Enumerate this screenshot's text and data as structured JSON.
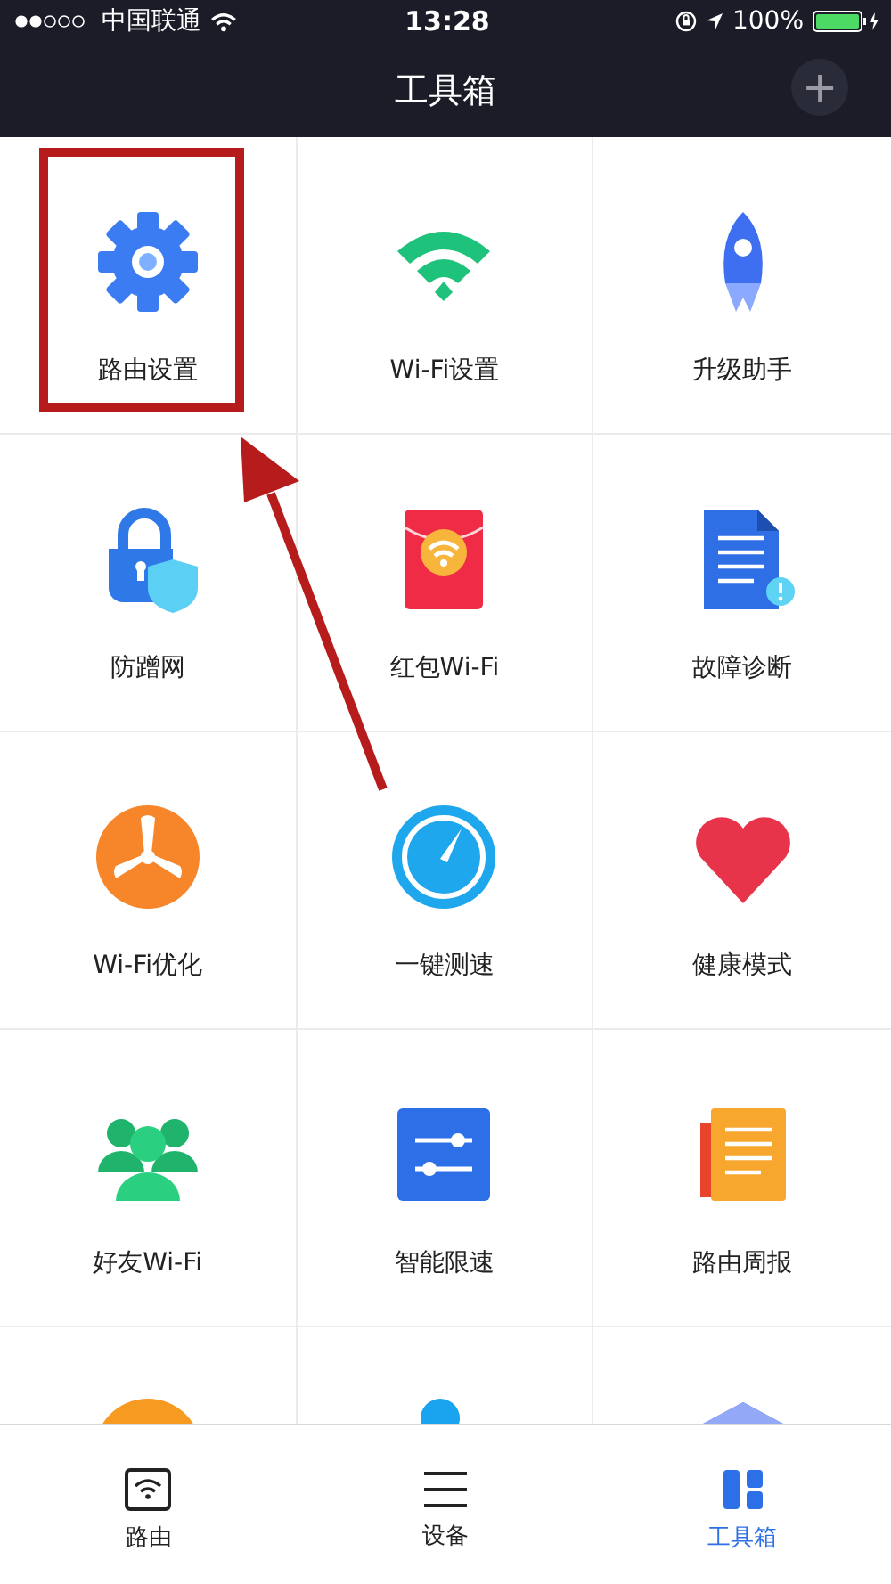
{
  "status_bar": {
    "carrier": "中国联通",
    "time": "13:28",
    "battery": "100%"
  },
  "header": {
    "title": "工具箱",
    "add_button": "+"
  },
  "tools": [
    {
      "kind": "gear",
      "label": "路由设置",
      "highlighted": true
    },
    {
      "kind": "wifi",
      "label": "Wi-Fi设置",
      "highlighted": false
    },
    {
      "kind": "rocket",
      "label": "升级助手",
      "highlighted": false
    },
    {
      "kind": "lock",
      "label": "防蹭网",
      "highlighted": false
    },
    {
      "kind": "envelope",
      "label": "红包Wi-Fi",
      "highlighted": false
    },
    {
      "kind": "document",
      "label": "故障诊断",
      "highlighted": false
    },
    {
      "kind": "fan",
      "label": "Wi-Fi优化",
      "highlighted": false
    },
    {
      "kind": "gauge",
      "label": "一键测速",
      "highlighted": false
    },
    {
      "kind": "heart",
      "label": "健康模式",
      "highlighted": false
    },
    {
      "kind": "people",
      "label": "好友Wi-Fi",
      "highlighted": false
    },
    {
      "kind": "sliders",
      "label": "智能限速",
      "highlighted": false
    },
    {
      "kind": "report",
      "label": "路由周报",
      "highlighted": false
    },
    {
      "kind": "power",
      "highlighted": false
    },
    {
      "kind": "useredit",
      "highlighted": false
    },
    {
      "kind": "cube",
      "highlighted": false
    }
  ],
  "tab_bar": [
    {
      "kind": "router",
      "label": "路由",
      "selected": false
    },
    {
      "kind": "devices",
      "label": "设备",
      "selected": false
    },
    {
      "kind": "toolbox",
      "label": "工具箱",
      "selected": true
    }
  ]
}
